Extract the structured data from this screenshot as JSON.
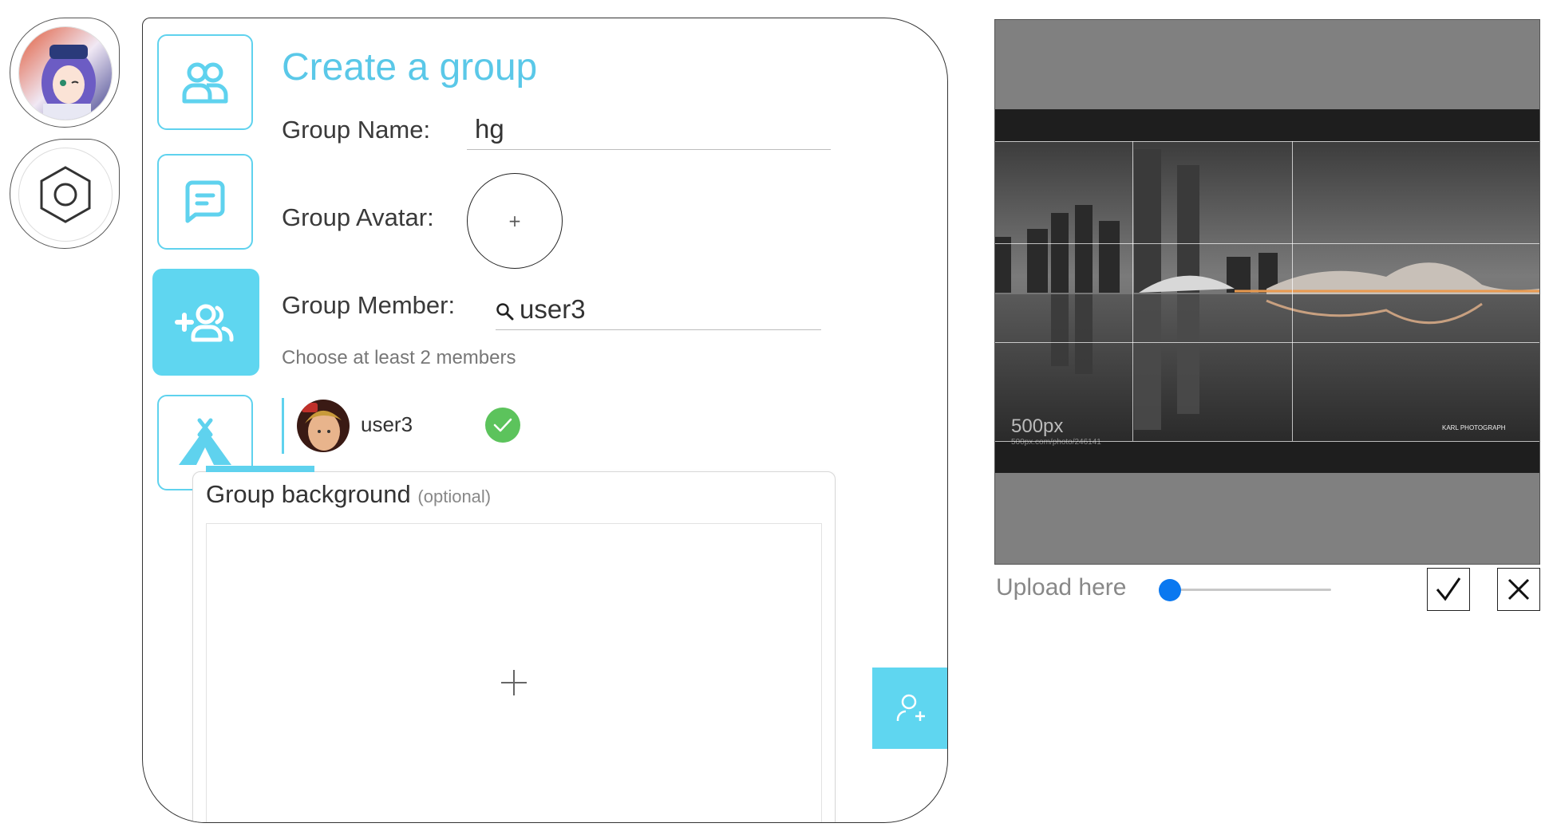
{
  "title": "Create a group",
  "form": {
    "group_name_label": "Group Name:",
    "group_name_value": "hg",
    "group_avatar_label": "Group Avatar:",
    "avatar_plus": "+",
    "group_member_label": "Group Member:",
    "member_search_value": "user3",
    "member_hint": "Choose at least 2 members"
  },
  "members": [
    {
      "name": "user3",
      "selected": true
    }
  ],
  "background": {
    "title": "Group background",
    "optional": "(optional)"
  },
  "crop": {
    "upload_label": "Upload here",
    "zoom": 0,
    "watermark": "500px",
    "watermark_url": "500px.com/photo/246141",
    "photographer": "KARL PHOTOGRAPH"
  },
  "colors": {
    "accent": "#5fd6f0",
    "title": "#5ac8e8",
    "check": "#5cc35c",
    "slider": "#0a78f0"
  },
  "icons": {
    "rail": [
      "user-avatar",
      "settings-hexagon-icon"
    ],
    "tabs": [
      "group-icon",
      "chat-icon",
      "add-group-icon",
      "camp-icon"
    ]
  }
}
